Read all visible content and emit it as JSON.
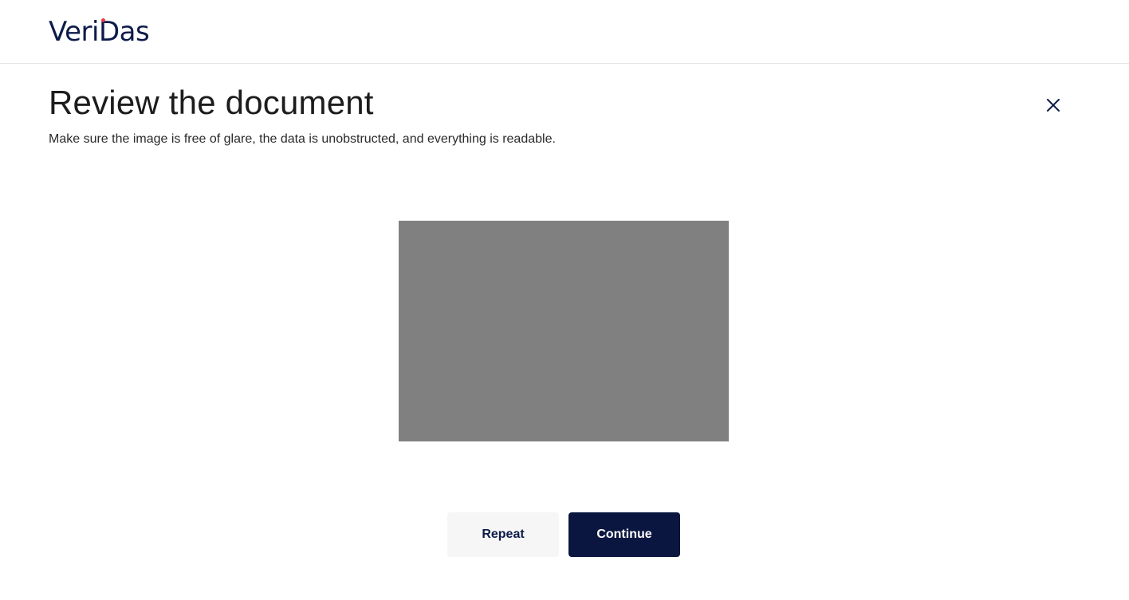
{
  "header": {
    "logo_text": "VeriDas",
    "brand_color": "#0d1b4b",
    "brand_accent": "#e8394b"
  },
  "main": {
    "title": "Review the document",
    "subtitle": "Make sure the image is free of glare, the data is unobstructed, and everything is readable.",
    "close_icon": "close-icon",
    "image_placeholder_color": "#808080"
  },
  "actions": {
    "repeat_label": "Repeat",
    "continue_label": "Continue",
    "continue_bg": "#0b1640"
  }
}
